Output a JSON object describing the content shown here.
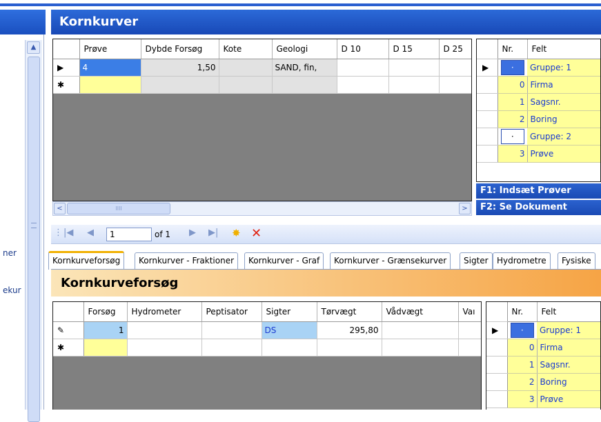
{
  "left": {
    "item1": "ner",
    "item2": "ekur"
  },
  "header": {
    "title": "Kornkurver"
  },
  "top_grid": {
    "columns": [
      "Prøve",
      "Dybde Forsøg",
      "Kote",
      "Geologi",
      "D 10",
      "D 15",
      "D 25"
    ],
    "row1": {
      "marker": "▶",
      "prove": "4",
      "dybde": "1,50",
      "kote": "",
      "geologi": "SAND, fin,"
    },
    "newrow_marker": "✱"
  },
  "felt_top": {
    "col_nr": "Nr.",
    "col_felt": "Felt",
    "rows": [
      {
        "nr": "·",
        "felt": "Gruppe: 1",
        "group": true
      },
      {
        "nr": "0",
        "felt": "Firma"
      },
      {
        "nr": "1",
        "felt": "Sagsnr."
      },
      {
        "nr": "2",
        "felt": "Boring"
      },
      {
        "nr": "·",
        "felt": "Gruppe: 2",
        "group": true
      },
      {
        "nr": "3",
        "felt": "Prøve"
      }
    ],
    "marker": "▶"
  },
  "fkeys": {
    "f1": "F1: Indsæt Prøver",
    "f2": "F2: Se Dokument"
  },
  "scroll": {
    "left": "<",
    "right": ">",
    "thumb": "IIII"
  },
  "nav": {
    "first": "|◀",
    "prev": "◀",
    "record": "1",
    "of": "of 1",
    "next": "▶",
    "last": "▶|",
    "new": "✸",
    "delete": "✕"
  },
  "tabs": [
    "Kornkurveforsøg",
    "Kornkurver - Fraktioner",
    "Kornkurver - Graf",
    "Kornkurver - Grænsekurver",
    "Sigter",
    "Hydrometre",
    "Fysiske"
  ],
  "section2": {
    "title": "Kornkurveforsøg"
  },
  "bottom_grid": {
    "columns": [
      "Forsøg",
      "Hydrometer",
      "Peptisator",
      "Sigter",
      "Tørvægt",
      "Vådvægt",
      "Vaı"
    ],
    "row1": {
      "marker": "✎",
      "forsog": "1",
      "hydrometer": "",
      "peptisator": "",
      "sigter": "DS",
      "torvaegt": "295,80",
      "vaadvaegt": ""
    },
    "newrow_marker": "✱"
  },
  "felt_bottom": {
    "col_nr": "Nr.",
    "col_felt": "Felt",
    "rows": [
      {
        "nr": "·",
        "felt": "Gruppe: 1",
        "group": true
      },
      {
        "nr": "0",
        "felt": "Firma"
      },
      {
        "nr": "1",
        "felt": "Sagsnr."
      },
      {
        "nr": "2",
        "felt": "Boring"
      },
      {
        "nr": "3",
        "felt": "Prøve"
      }
    ],
    "marker": "▶"
  }
}
